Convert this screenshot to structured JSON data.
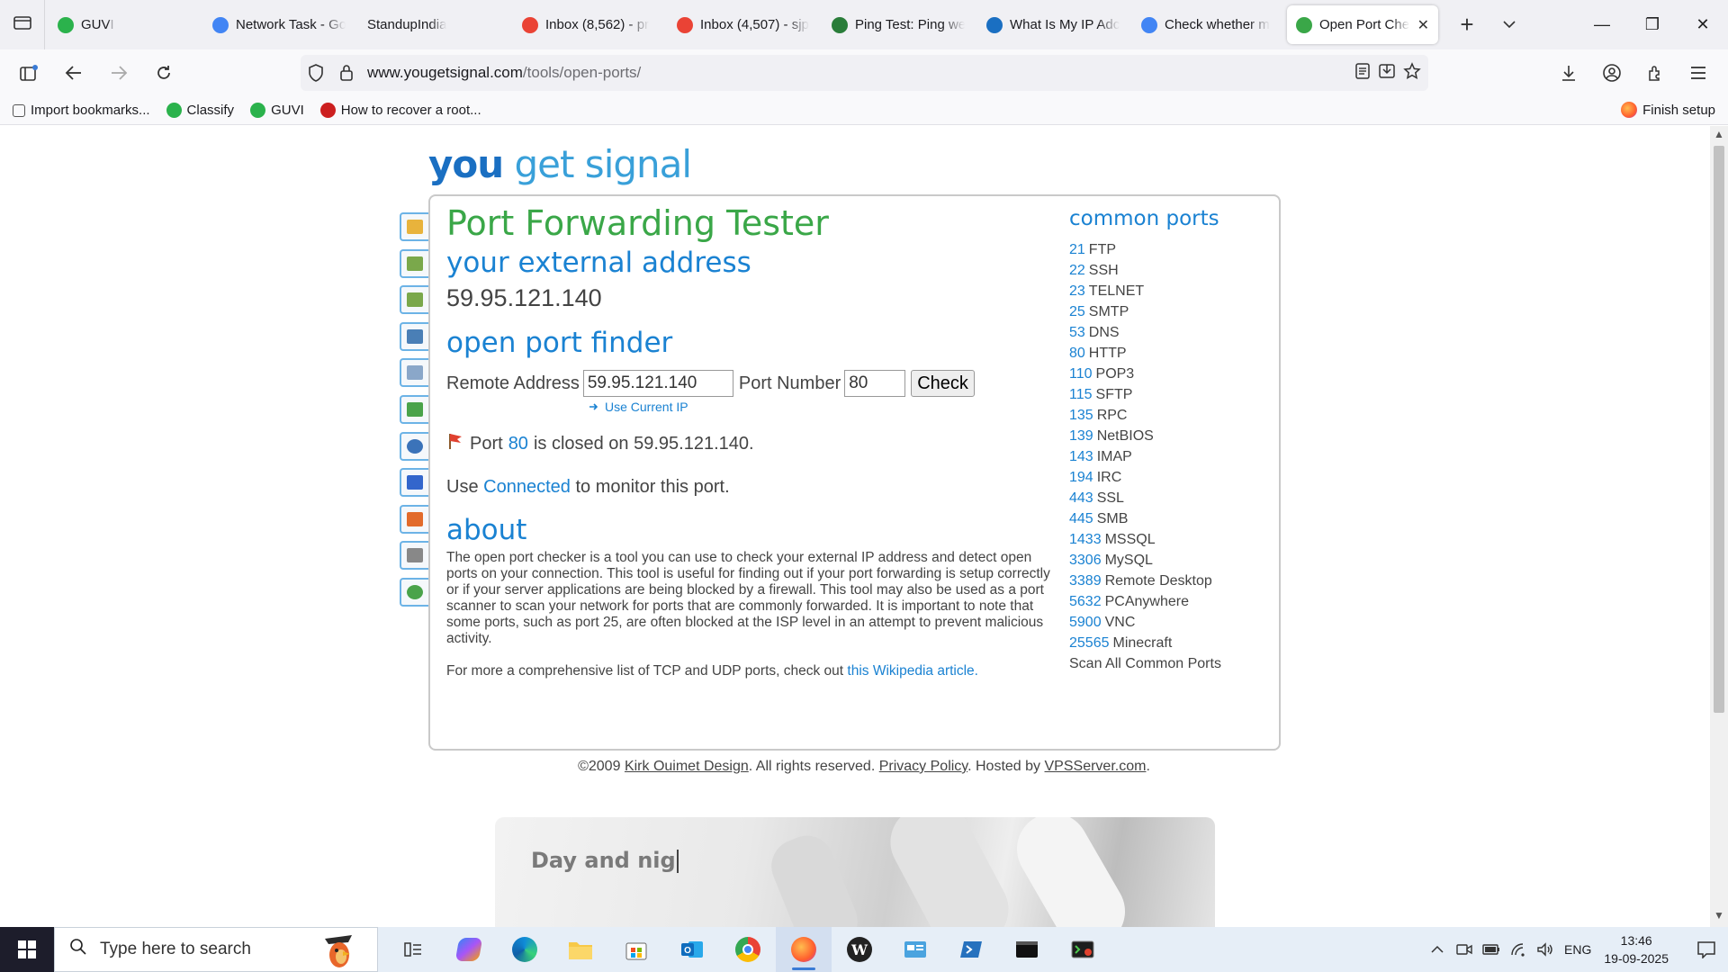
{
  "browser": {
    "tabs": [
      {
        "label": "GUVI",
        "favicon": "guvi-icon",
        "color": "#2bb24c"
      },
      {
        "label": "Network Task - Go",
        "favicon": "docs-icon",
        "color": "#4285f4"
      },
      {
        "label": "StandupIndia",
        "favicon": "",
        "color": ""
      },
      {
        "label": "Inbox (8,562) - pr",
        "favicon": "gmail-icon",
        "color": "#ea4335"
      },
      {
        "label": "Inbox (4,507) - sjp",
        "favicon": "gmail-icon",
        "color": "#ea4335"
      },
      {
        "label": "Ping Test: Ping we",
        "favicon": "ping-icon",
        "color": "#2a7d3a"
      },
      {
        "label": "What Is My IP Adc",
        "favicon": "globe-icon",
        "color": "#1a6fc2"
      },
      {
        "label": "Check whether m",
        "favicon": "google-icon",
        "color": "#4285f4"
      },
      {
        "label": "Open Port Che",
        "favicon": "globe-icon",
        "color": "#3aa748",
        "active": true
      }
    ],
    "url_host": "www.yougetsignal.com",
    "url_path": "/tools/open-ports/",
    "bookmarks": [
      {
        "label": "Import bookmarks...",
        "icon": "import-icon"
      },
      {
        "label": "Classify",
        "icon": "guvi-icon"
      },
      {
        "label": "GUVI",
        "icon": "guvi-icon"
      },
      {
        "label": "How to recover a root...",
        "icon": "redhat-icon"
      }
    ],
    "finish_setup": "Finish setup"
  },
  "page": {
    "logo_you": "you",
    "logo_rest": " get signal",
    "title": "Port Forwarding Tester",
    "external_heading": "your external address",
    "external_ip": "59.95.121.140",
    "finder_heading": "open port finder",
    "remote_label": "Remote Address",
    "remote_value": "59.95.121.140",
    "port_label": "Port Number",
    "port_value": "80",
    "check_label": "Check",
    "use_current_ip": "Use Current IP",
    "result_prefix": "Port",
    "result_port": "80",
    "result_suffix": "is closed on 59.95.121.140.",
    "monitor_prefix": "Use",
    "monitor_link": "Connected",
    "monitor_suffix": "to monitor this port.",
    "about_heading": "about",
    "about_text": "The open port checker is a tool you can use to check your external IP address and detect open ports on your connection. This tool is useful for finding out if your port forwarding is setup correctly or if your server applications are being blocked by a firewall. This tool may also be used as a port scanner to scan your network for ports that are commonly forwarded. It is important to note that some ports, such as port 25, are often blocked at the ISP level in an attempt to prevent malicious activity.",
    "wiki_prefix": "For more a comprehensive list of TCP and UDP ports, check out",
    "wiki_link": "this Wikipedia article.",
    "common_heading": "common ports",
    "ports": [
      {
        "num": "21",
        "name": "FTP"
      },
      {
        "num": "22",
        "name": "SSH"
      },
      {
        "num": "23",
        "name": "TELNET"
      },
      {
        "num": "25",
        "name": "SMTP"
      },
      {
        "num": "53",
        "name": "DNS"
      },
      {
        "num": "80",
        "name": "HTTP"
      },
      {
        "num": "110",
        "name": "POP3"
      },
      {
        "num": "115",
        "name": "SFTP"
      },
      {
        "num": "135",
        "name": "RPC"
      },
      {
        "num": "139",
        "name": "NetBIOS"
      },
      {
        "num": "143",
        "name": "IMAP"
      },
      {
        "num": "194",
        "name": "IRC"
      },
      {
        "num": "443",
        "name": "SSL"
      },
      {
        "num": "445",
        "name": "SMB"
      },
      {
        "num": "1433",
        "name": "MSSQL"
      },
      {
        "num": "3306",
        "name": "MySQL"
      },
      {
        "num": "3389",
        "name": "Remote Desktop"
      },
      {
        "num": "5632",
        "name": "PCAnywhere"
      },
      {
        "num": "5900",
        "name": "VNC"
      },
      {
        "num": "25565",
        "name": "Minecraft"
      }
    ],
    "scan_all": "Scan All Common Ports",
    "footer_copyright": "©2009",
    "footer_author": "Kirk Ouimet Design",
    "footer_rights": ". All rights reserved.",
    "footer_privacy": "Privacy Policy",
    "footer_hosted": ". Hosted by",
    "footer_host": "VPSServer.com",
    "footer_end": ".",
    "banner_text": "Day and nig",
    "side_tools": [
      "lock-icon",
      "map-icon",
      "map-icon",
      "server-icon",
      "mail-icon",
      "network-icon",
      "help-icon",
      "google-icon",
      "windows-icon",
      "disk-icon",
      "globe-icon"
    ]
  },
  "taskbar": {
    "search_placeholder": "Type here to search",
    "lang": "ENG",
    "time": "13:46",
    "date": "19-09-2025"
  }
}
